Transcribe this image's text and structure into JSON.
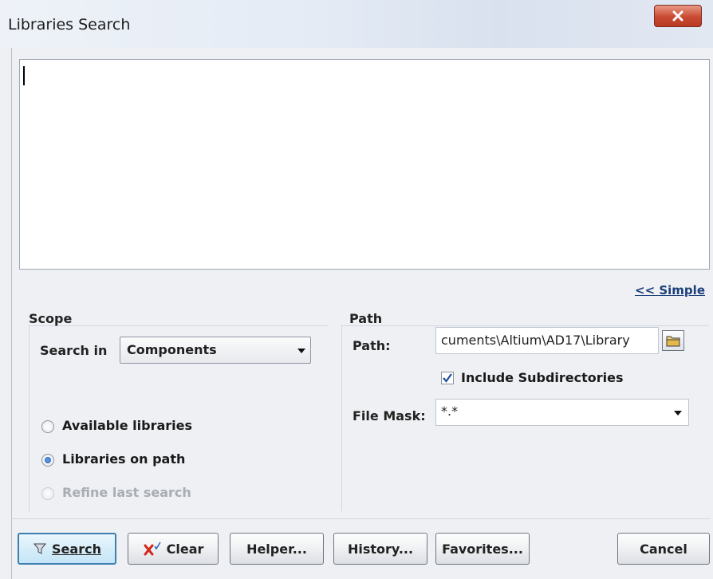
{
  "window": {
    "title": "Libraries Search"
  },
  "simple_link": "<< Simple",
  "scope": {
    "heading": "Scope",
    "search_in_label": "Search in",
    "search_in_value": "Components",
    "radios": [
      {
        "label": "Available libraries",
        "selected": false,
        "enabled": true
      },
      {
        "label": "Libraries on path",
        "selected": true,
        "enabled": true
      },
      {
        "label": "Refine last search",
        "selected": false,
        "enabled": false
      }
    ]
  },
  "path": {
    "heading": "Path",
    "path_label": "Path:",
    "path_value": "cuments\\Altium\\AD17\\Library",
    "include_subdirectories_label": "Include Subdirectories",
    "include_subdirectories_checked": true,
    "file_mask_label": "File Mask:",
    "file_mask_value": "*.*"
  },
  "buttons": {
    "search": "Search",
    "clear": "Clear",
    "helper": "Helper...",
    "history": "History...",
    "favorites": "Favorites...",
    "cancel": "Cancel"
  },
  "colors": {
    "close_button": "#c94a32",
    "link": "#1b3f7a",
    "radio_selected": "#1f5ab8"
  }
}
